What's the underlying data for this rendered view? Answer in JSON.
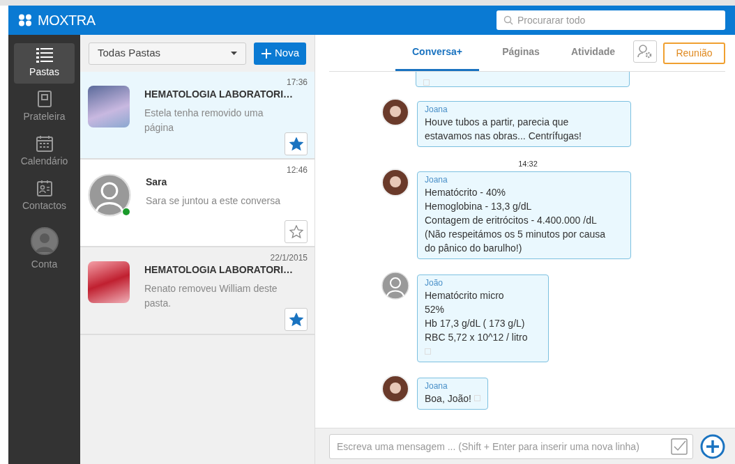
{
  "header": {
    "logo": "MOXTRA",
    "search": {
      "placeholder": "Procurarar todo"
    }
  },
  "sidebar": {
    "items": [
      {
        "label": "Pastas",
        "selected": true
      },
      {
        "label": "Prateleira",
        "selected": false
      },
      {
        "label": "Calendário",
        "selected": false
      },
      {
        "label": "Contactos",
        "selected": false
      },
      {
        "label": "Conta",
        "selected": false
      }
    ]
  },
  "folders": {
    "filter": "Todas Pastas",
    "new_button": "Nova",
    "items": [
      {
        "kind": "folder",
        "title": "HEMATOLOGIA LABORATORI…",
        "time": "17:36",
        "preview": "Estela tenha removido uma página",
        "starred": true,
        "selected": true,
        "online": false
      },
      {
        "kind": "contact",
        "title": "Sara",
        "time": "12:46",
        "preview": "Sara se juntou a este conversa",
        "starred": false,
        "selected": false,
        "online": true
      },
      {
        "kind": "folder",
        "title": "HEMATOLOGIA LABORATORI…",
        "time": "22/1/2015",
        "preview": "Renato removeu William deste pasta.",
        "starred": true,
        "selected": false,
        "online": false
      }
    ]
  },
  "chat": {
    "tabs": [
      {
        "label": "Conversa+",
        "selected": true
      },
      {
        "label": "Páginas",
        "selected": false
      },
      {
        "label": "Atividade",
        "selected": false
      }
    ],
    "meeting_button": "Reunião",
    "messages": [
      {
        "kind": "clipped",
        "mark": true
      },
      {
        "kind": "message",
        "sender": "Joana",
        "avatar": {
          "kind": "photo"
        },
        "lines": [
          "Houve tubos a partir, parecia que",
          "estavamos nas obras... Centrífugas!"
        ],
        "mark": false
      },
      {
        "kind": "time",
        "text": "14:32"
      },
      {
        "kind": "message",
        "sender": "Joana",
        "avatar": {
          "kind": "photo"
        },
        "lines": [
          "Hematócrito - 40%",
          "Hemoglobina - 13,3 g/dL",
          "Contagem de eritrócitos - 4.400.000 /dL",
          "(Não respeitámos os 5 minutos por causa",
          "do pânico do barulho!)"
        ],
        "mark": false
      },
      {
        "kind": "message",
        "sender": "João",
        "avatar": {
          "kind": "contact"
        },
        "lines": [
          "Hematócrito micro",
          "52%",
          "Hb 17,3 g/dL ( 173 g/L)",
          "RBC 5,72 x 10^12 / litro"
        ],
        "mark": true
      },
      {
        "kind": "message",
        "sender": "Joana",
        "avatar": {
          "kind": "photo"
        },
        "lines": [
          "Boa, João!"
        ],
        "mark": true
      }
    ],
    "composer": {
      "placeholder": "Escreva uma mensagem ... (Shift + Enter para inserir uma nova linha)"
    }
  }
}
